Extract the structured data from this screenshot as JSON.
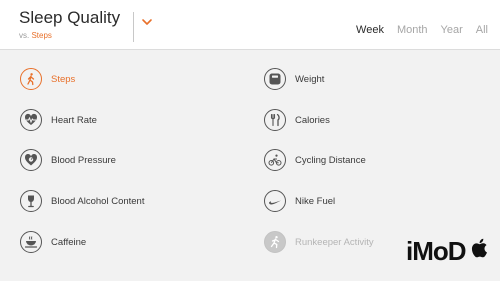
{
  "header": {
    "title": "Sleep Quality",
    "vs_prefix": "vs.",
    "vs_metric": "Steps"
  },
  "tabs": [
    {
      "label": "Week",
      "active": true
    },
    {
      "label": "Month",
      "active": false
    },
    {
      "label": "Year",
      "active": false
    },
    {
      "label": "All",
      "active": false
    }
  ],
  "metrics_left": [
    {
      "label": "Steps",
      "icon": "walking-person-icon",
      "selected": true
    },
    {
      "label": "Heart Rate",
      "icon": "heart-pulse-icon"
    },
    {
      "label": "Blood Pressure",
      "icon": "heart-pressure-icon"
    },
    {
      "label": "Blood Alcohol Content",
      "icon": "wine-glass-icon"
    },
    {
      "label": "Caffeine",
      "icon": "coffee-cup-icon"
    }
  ],
  "metrics_right": [
    {
      "label": "Weight",
      "icon": "scale-icon"
    },
    {
      "label": "Calories",
      "icon": "fork-knife-icon"
    },
    {
      "label": "Cycling Distance",
      "icon": "cyclist-icon"
    },
    {
      "label": "Nike Fuel",
      "icon": "nike-swoosh-icon"
    },
    {
      "label": "Runkeeper Activity",
      "icon": "runner-icon",
      "disabled": true
    }
  ],
  "watermark": {
    "text": "iMoD"
  },
  "colors": {
    "accent": "#e8702a",
    "background": "#f2f2f2",
    "header": "#ffffff"
  }
}
